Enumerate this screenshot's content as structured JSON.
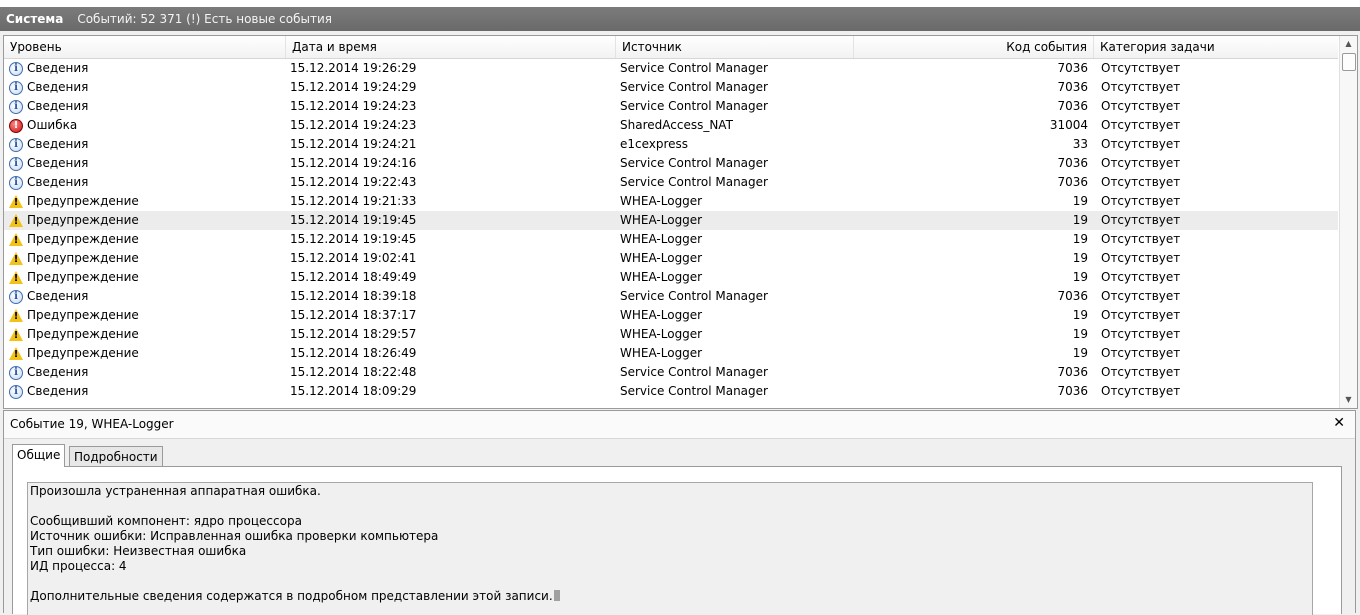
{
  "title": "Система",
  "events_info": "Событий: 52 371 (!) Есть новые события",
  "columns": {
    "level": "Уровень",
    "datetime": "Дата и время",
    "source": "Источник",
    "code": "Код события",
    "category": "Категория задачи"
  },
  "rows": [
    {
      "type": "info",
      "level": "Сведения",
      "datetime": "15.12.2014 19:26:29",
      "source": "Service Control Manager",
      "code": "7036",
      "category": "Отсутствует"
    },
    {
      "type": "info",
      "level": "Сведения",
      "datetime": "15.12.2014 19:24:29",
      "source": "Service Control Manager",
      "code": "7036",
      "category": "Отсутствует"
    },
    {
      "type": "info",
      "level": "Сведения",
      "datetime": "15.12.2014 19:24:23",
      "source": "Service Control Manager",
      "code": "7036",
      "category": "Отсутствует"
    },
    {
      "type": "error",
      "level": "Ошибка",
      "datetime": "15.12.2014 19:24:23",
      "source": "SharedAccess_NAT",
      "code": "31004",
      "category": "Отсутствует"
    },
    {
      "type": "info",
      "level": "Сведения",
      "datetime": "15.12.2014 19:24:21",
      "source": "e1cexpress",
      "code": "33",
      "category": "Отсутствует"
    },
    {
      "type": "info",
      "level": "Сведения",
      "datetime": "15.12.2014 19:24:16",
      "source": "Service Control Manager",
      "code": "7036",
      "category": "Отсутствует"
    },
    {
      "type": "info",
      "level": "Сведения",
      "datetime": "15.12.2014 19:22:43",
      "source": "Service Control Manager",
      "code": "7036",
      "category": "Отсутствует"
    },
    {
      "type": "warning",
      "level": "Предупреждение",
      "datetime": "15.12.2014 19:21:33",
      "source": "WHEA-Logger",
      "code": "19",
      "category": "Отсутствует"
    },
    {
      "type": "warning",
      "level": "Предупреждение",
      "datetime": "15.12.2014 19:19:45",
      "source": "WHEA-Logger",
      "code": "19",
      "category": "Отсутствует",
      "selected": true
    },
    {
      "type": "warning",
      "level": "Предупреждение",
      "datetime": "15.12.2014 19:19:45",
      "source": "WHEA-Logger",
      "code": "19",
      "category": "Отсутствует"
    },
    {
      "type": "warning",
      "level": "Предупреждение",
      "datetime": "15.12.2014 19:02:41",
      "source": "WHEA-Logger",
      "code": "19",
      "category": "Отсутствует"
    },
    {
      "type": "warning",
      "level": "Предупреждение",
      "datetime": "15.12.2014 18:49:49",
      "source": "WHEA-Logger",
      "code": "19",
      "category": "Отсутствует"
    },
    {
      "type": "info",
      "level": "Сведения",
      "datetime": "15.12.2014 18:39:18",
      "source": "Service Control Manager",
      "code": "7036",
      "category": "Отсутствует"
    },
    {
      "type": "warning",
      "level": "Предупреждение",
      "datetime": "15.12.2014 18:37:17",
      "source": "WHEA-Logger",
      "code": "19",
      "category": "Отсутствует"
    },
    {
      "type": "warning",
      "level": "Предупреждение",
      "datetime": "15.12.2014 18:29:57",
      "source": "WHEA-Logger",
      "code": "19",
      "category": "Отсутствует"
    },
    {
      "type": "warning",
      "level": "Предупреждение",
      "datetime": "15.12.2014 18:26:49",
      "source": "WHEA-Logger",
      "code": "19",
      "category": "Отсутствует"
    },
    {
      "type": "info",
      "level": "Сведения",
      "datetime": "15.12.2014 18:22:48",
      "source": "Service Control Manager",
      "code": "7036",
      "category": "Отсутствует"
    },
    {
      "type": "info",
      "level": "Сведения",
      "datetime": "15.12.2014 18:09:29",
      "source": "Service Control Manager",
      "code": "7036",
      "category": "Отсутствует"
    }
  ],
  "detail": {
    "title": "Событие 19, WHEA-Logger",
    "close": "✕",
    "tabs": [
      "Общие",
      "Подробности"
    ],
    "lines": [
      "Произошла устраненная аппаратная ошибка.",
      "",
      "Сообщивший компонент: ядро процессора",
      "Источник ошибки: Исправленная ошибка проверки компьютера",
      "Тип ошибки: Неизвестная ошибка",
      "ИД процесса: 4",
      "",
      "Дополнительные сведения содержатся в подробном представлении этой записи."
    ]
  }
}
